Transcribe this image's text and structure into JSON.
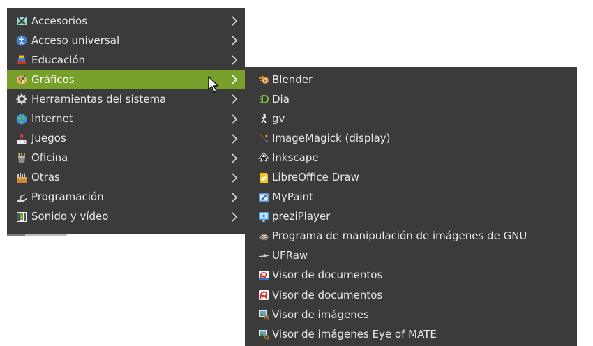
{
  "main_menu": {
    "items": [
      {
        "label": "Accesorios",
        "icon": "accessories-icon",
        "active": false
      },
      {
        "label": "Acceso universal",
        "icon": "accessibility-icon",
        "active": false
      },
      {
        "label": "Educación",
        "icon": "education-icon",
        "active": false
      },
      {
        "label": "Gráficos",
        "icon": "graphics-icon",
        "active": true
      },
      {
        "label": "Herramientas del sistema",
        "icon": "system-tools-icon",
        "active": false
      },
      {
        "label": "Internet",
        "icon": "internet-globe-icon",
        "active": false
      },
      {
        "label": "Juegos",
        "icon": "games-joystick-icon",
        "active": false
      },
      {
        "label": "Oficina",
        "icon": "office-icon",
        "active": false
      },
      {
        "label": "Otras",
        "icon": "other-icon",
        "active": false
      },
      {
        "label": "Programación",
        "icon": "programming-icon",
        "active": false
      },
      {
        "label": "Sonido y vídeo",
        "icon": "multimedia-icon",
        "active": false
      }
    ]
  },
  "submenu": {
    "items": [
      {
        "label": "Blender",
        "icon": "blender-icon"
      },
      {
        "label": "Dia",
        "icon": "dia-icon"
      },
      {
        "label": "gv",
        "icon": "gv-icon"
      },
      {
        "label": "ImageMagick (display)",
        "icon": "imagemagick-icon"
      },
      {
        "label": "Inkscape",
        "icon": "inkscape-icon"
      },
      {
        "label": "LibreOffice Draw",
        "icon": "libreoffice-draw-icon"
      },
      {
        "label": "MyPaint",
        "icon": "mypaint-icon"
      },
      {
        "label": "preziPlayer",
        "icon": "prezi-icon"
      },
      {
        "label": "Programa de manipulación de imágenes de GNU",
        "icon": "gimp-icon"
      },
      {
        "label": "UFRaw",
        "icon": "ufraw-icon"
      },
      {
        "label": "Visor de documentos",
        "icon": "document-viewer-icon"
      },
      {
        "label": "Visor de documentos",
        "icon": "pdf-viewer-icon"
      },
      {
        "label": "Visor de imágenes",
        "icon": "image-viewer-icon"
      },
      {
        "label": "Visor de imágenes Eye of MATE",
        "icon": "eye-of-mate-icon"
      }
    ]
  },
  "colors": {
    "menu_bg": "#3b3b3b",
    "active_bg": "#77a02a",
    "text": "#e8e8e8"
  }
}
